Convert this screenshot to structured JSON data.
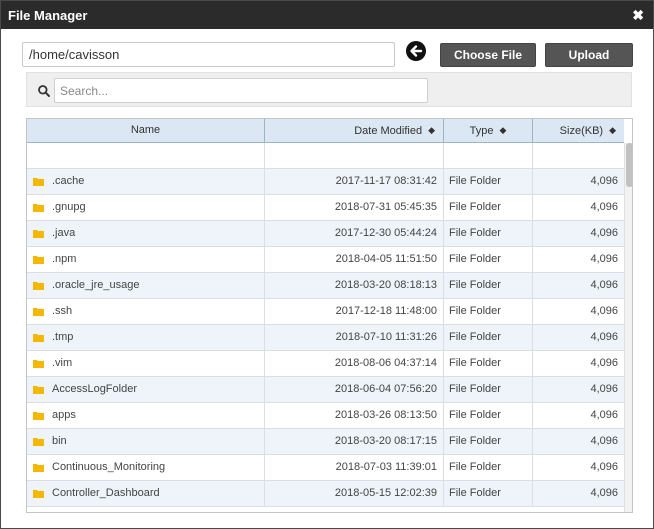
{
  "window": {
    "title": "File Manager",
    "close_glyph": "✖"
  },
  "toolbar": {
    "path_value": "/home/cavisson",
    "choose_label": "Choose File",
    "upload_label": "Upload"
  },
  "search": {
    "placeholder": "Search...",
    "value": ""
  },
  "table": {
    "columns": {
      "name": "Name",
      "date": "Date Modified",
      "type": "Type",
      "size": "Size(KB)"
    },
    "sort_glyph": "◆",
    "rows": [
      {
        "name": ".cache",
        "date": "2017-11-17 08:31:42",
        "type": "File Folder",
        "size": "4,096"
      },
      {
        "name": ".gnupg",
        "date": "2018-07-31 05:45:35",
        "type": "File Folder",
        "size": "4,096"
      },
      {
        "name": ".java",
        "date": "2017-12-30 05:44:24",
        "type": "File Folder",
        "size": "4,096"
      },
      {
        "name": ".npm",
        "date": "2018-04-05 11:51:50",
        "type": "File Folder",
        "size": "4,096"
      },
      {
        "name": ".oracle_jre_usage",
        "date": "2018-03-20 08:18:13",
        "type": "File Folder",
        "size": "4,096"
      },
      {
        "name": ".ssh",
        "date": "2017-12-18 11:48:00",
        "type": "File Folder",
        "size": "4,096"
      },
      {
        "name": ".tmp",
        "date": "2018-07-10 11:31:26",
        "type": "File Folder",
        "size": "4,096"
      },
      {
        "name": ".vim",
        "date": "2018-08-06 04:37:14",
        "type": "File Folder",
        "size": "4,096"
      },
      {
        "name": "AccessLogFolder",
        "date": "2018-06-04 07:56:20",
        "type": "File Folder",
        "size": "4,096"
      },
      {
        "name": "apps",
        "date": "2018-03-26 08:13:50",
        "type": "File Folder",
        "size": "4,096"
      },
      {
        "name": "bin",
        "date": "2018-03-20 08:17:15",
        "type": "File Folder",
        "size": "4,096"
      },
      {
        "name": "Continuous_Monitoring",
        "date": "2018-07-03 11:39:01",
        "type": "File Folder",
        "size": "4,096"
      },
      {
        "name": "Controller_Dashboard",
        "date": "2018-05-15 12:02:39",
        "type": "File Folder",
        "size": "4,096"
      }
    ]
  },
  "icons": {
    "back": "arrow-left-circle-icon",
    "search": "search-icon",
    "folder": "folder-icon",
    "close": "close-icon"
  },
  "colors": {
    "titlebar": "#2b2b2b",
    "button": "#555555",
    "header": "#dbe7f2",
    "row_alt": "#eef4f9",
    "folder": "#f5b800"
  }
}
